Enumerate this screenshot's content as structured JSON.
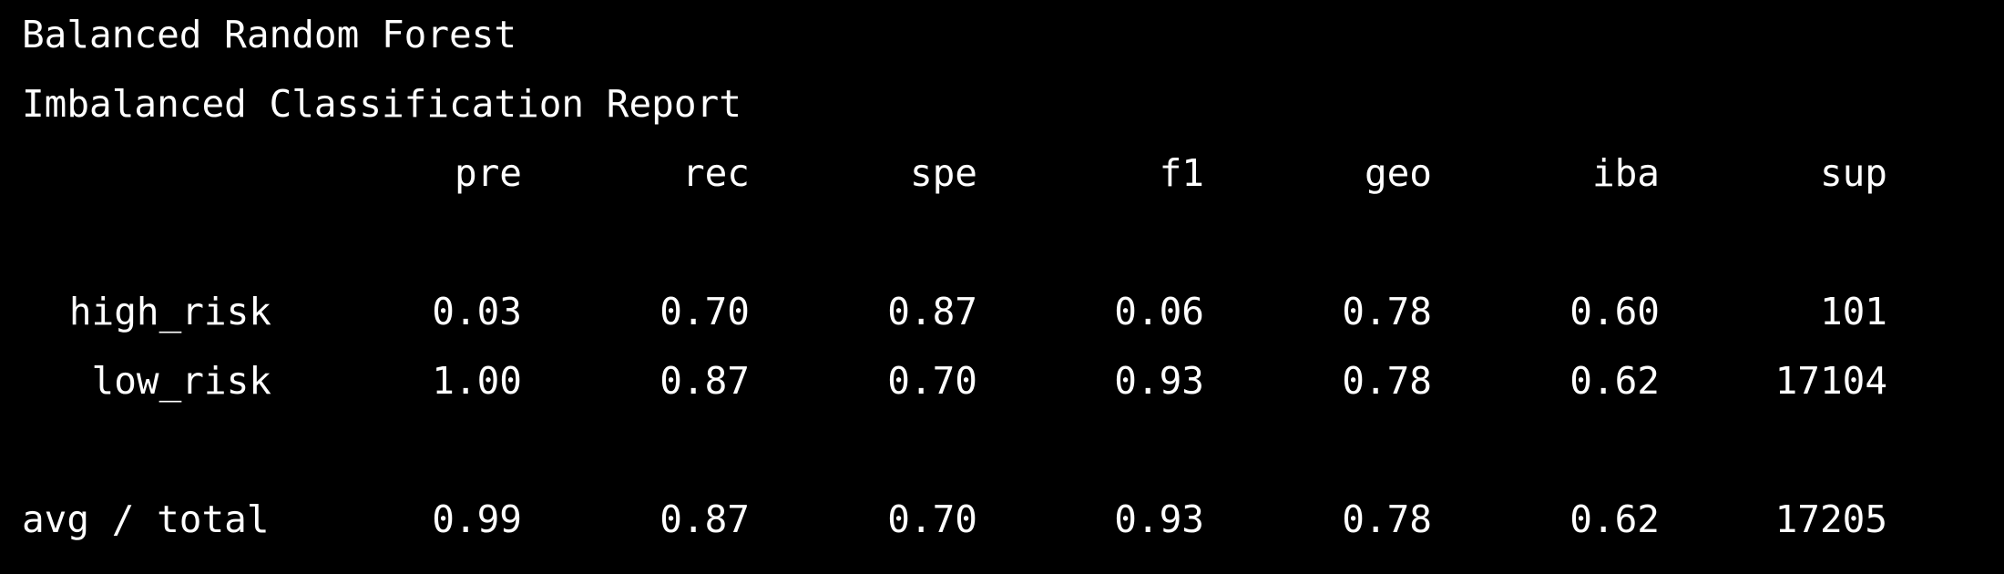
{
  "terminal": {
    "title_line": "Balanced Random Forest",
    "report_title": "Imbalanced Classification Report",
    "text_color": "#ffffff",
    "background_color": "#000000"
  },
  "report": {
    "headers": [
      "pre",
      "rec",
      "spe",
      "f1",
      "geo",
      "iba",
      "sup"
    ],
    "rows": [
      {
        "label": "high_risk",
        "values": [
          "0.03",
          "0.70",
          "0.87",
          "0.06",
          "0.78",
          "0.60",
          "101"
        ]
      },
      {
        "label": "low_risk",
        "values": [
          "1.00",
          "0.87",
          "0.70",
          "0.93",
          "0.78",
          "0.62",
          "17104"
        ]
      }
    ],
    "total": {
      "label": "avg / total",
      "values": [
        "0.99",
        "0.87",
        "0.70",
        "0.93",
        "0.78",
        "0.62",
        "17205"
      ]
    }
  }
}
